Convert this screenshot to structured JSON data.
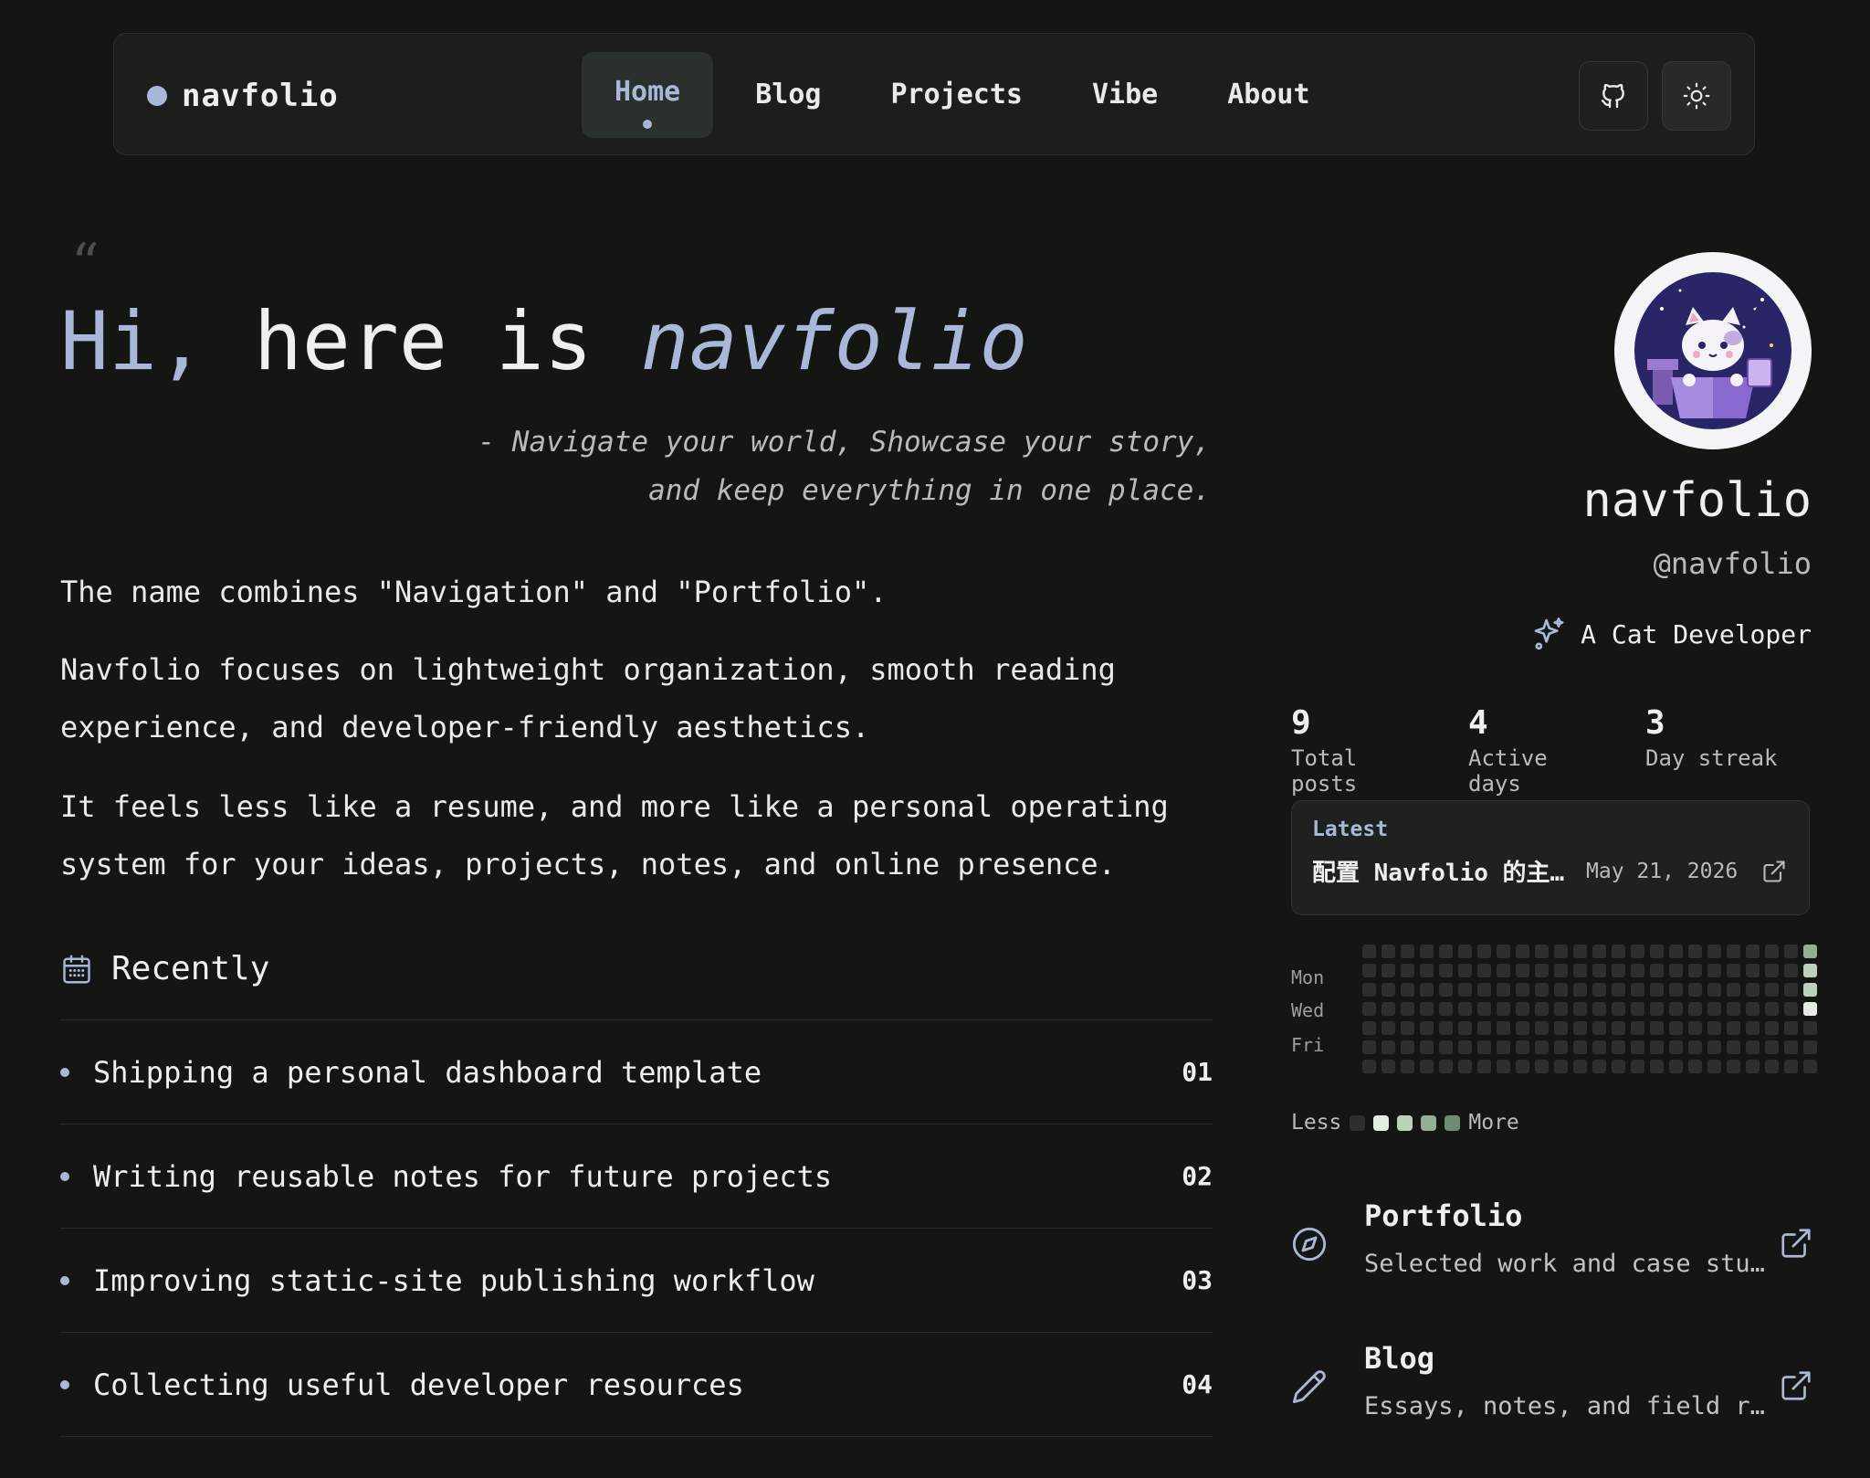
{
  "brand": {
    "name": "navfolio",
    "accent": "#a9b8d8"
  },
  "nav": {
    "links": [
      {
        "label": "Home",
        "active": true
      },
      {
        "label": "Blog"
      },
      {
        "label": "Projects"
      },
      {
        "label": "Vibe"
      },
      {
        "label": "About"
      }
    ],
    "github_icon": "github-icon",
    "theme_icon": "sun-icon"
  },
  "hero": {
    "quote_glyph": "“",
    "title_prefix": "Hi,",
    "title_mid": " here is ",
    "title_name": "navfolio",
    "tagline_line1": "- Navigate your world, Showcase your story,",
    "tagline_line2": "and keep everything in one place.",
    "paragraph1": "The name combines \"Navigation\" and \"Portfolio\".",
    "paragraph2": "Navfolio focuses on lightweight organization, smooth reading experience, and developer-friendly aesthetics.",
    "paragraph3": "It feels less like a resume, and more like a personal operating system for your ideas, projects, notes, and online presence."
  },
  "recently": {
    "title": "Recently",
    "icon": "calendar-icon",
    "items": [
      {
        "text": "Shipping a personal dashboard template",
        "num": "01"
      },
      {
        "text": "Writing reusable notes for future projects",
        "num": "02"
      },
      {
        "text": "Improving static-site publishing workflow",
        "num": "03"
      },
      {
        "text": "Collecting useful developer resources",
        "num": "04"
      }
    ]
  },
  "profile": {
    "name": "navfolio",
    "handle": "@navfolio",
    "role": "A Cat Developer",
    "role_icon": "sparkles-icon",
    "stats": [
      {
        "value": "9",
        "label": "Total posts"
      },
      {
        "value": "4",
        "label": "Active days"
      },
      {
        "value": "3",
        "label": "Day streak"
      }
    ],
    "latest": {
      "label": "Latest",
      "title": "配置 Navfolio 的主…",
      "date": "May 21, 2026",
      "icon": "external-link-icon"
    },
    "heatmap": {
      "day_labels": [
        "Mon",
        "Wed",
        "Fri"
      ],
      "weeks": 24,
      "active_cells": [
        {
          "week": 23,
          "day": 0,
          "level": 3
        },
        {
          "week": 23,
          "day": 1,
          "level": 2
        },
        {
          "week": 23,
          "day": 2,
          "level": 2
        },
        {
          "week": 23,
          "day": 3,
          "level": 1
        }
      ],
      "colors": [
        "#2b302c",
        "#e4ebe2",
        "#bcd0bc",
        "#95ae96",
        "#6f8c71"
      ],
      "legend_less": "Less",
      "legend_more": "More"
    },
    "links": [
      {
        "title": "Portfolio",
        "desc": "Selected work and case stu…",
        "icon": "compass-icon"
      },
      {
        "title": "Blog",
        "desc": "Essays, notes, and field r…",
        "icon": "pencil-icon"
      }
    ]
  }
}
